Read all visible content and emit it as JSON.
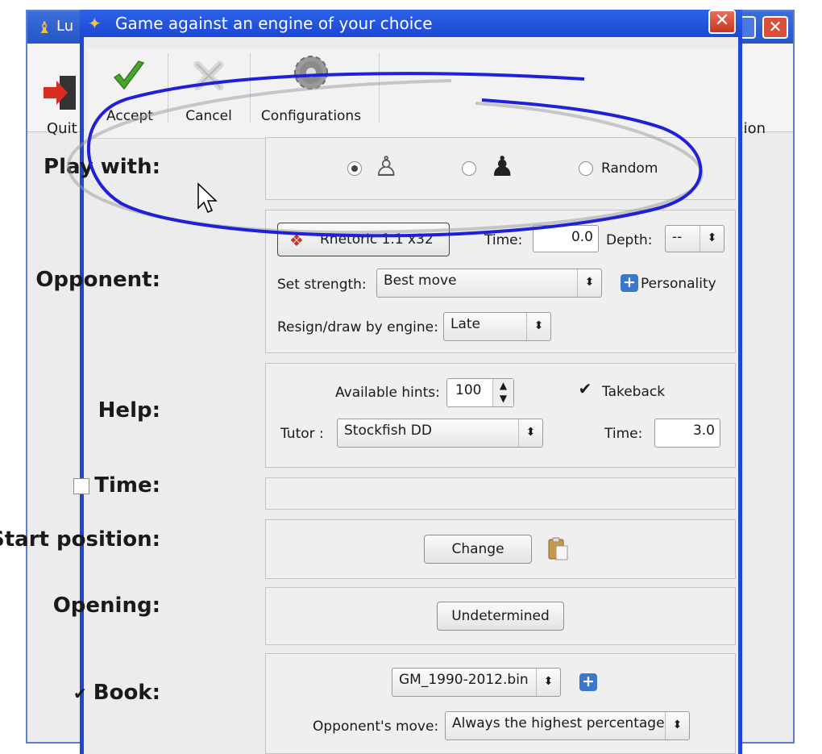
{
  "parent": {
    "title_fragment": "Lu",
    "quit_label": "Quit",
    "right_label": "ion"
  },
  "dialog": {
    "title": "Game against an engine of your choice",
    "close_glyph": "✕"
  },
  "toolbar": {
    "accept_label": "Accept",
    "cancel_label": "Cancel",
    "configurations_label": "Configurations"
  },
  "play_with": {
    "label": "Play with:",
    "options": [
      {
        "type": "white-pawn",
        "selected": true
      },
      {
        "type": "black-pawn",
        "selected": false
      },
      {
        "type": "random",
        "label": "Random",
        "selected": false
      }
    ],
    "glyphs": {
      "white": "♙",
      "black": "♟"
    }
  },
  "opponent": {
    "label": "Opponent:",
    "engine_button": "Rhetoric 1.1 x32",
    "time_label": "Time:",
    "time_value": "0.0",
    "depth_label": "Depth:",
    "depth_value": "--",
    "strength_label": "Set strength:",
    "strength_value": "Best move",
    "personality_label": "Personality",
    "resign_label": "Resign/draw by engine:",
    "resign_value": "Late"
  },
  "help": {
    "label": "Help:",
    "hints_label": "Available hints:",
    "hints_value": "100",
    "takeback_label": "Takeback",
    "takeback_checked": true,
    "tutor_label": "Tutor :",
    "tutor_value": "Stockfish DD",
    "time_label": "Time:",
    "time_value": "3.0"
  },
  "time_section": {
    "label": "Time:",
    "checked": false
  },
  "start_position": {
    "label": "Start position:",
    "button": "Change"
  },
  "opening": {
    "label": "Opening:",
    "button": "Undetermined"
  },
  "book": {
    "label": "Book:",
    "checked": true,
    "file": "GM_1990-2012.bin",
    "move_label": "Opponent's move:",
    "move_value": "Always the highest percentage"
  },
  "colors": {
    "titlebar": "#1f46d6",
    "annotation_blue": "#2020d8",
    "accept_green": "#4aa52e"
  }
}
